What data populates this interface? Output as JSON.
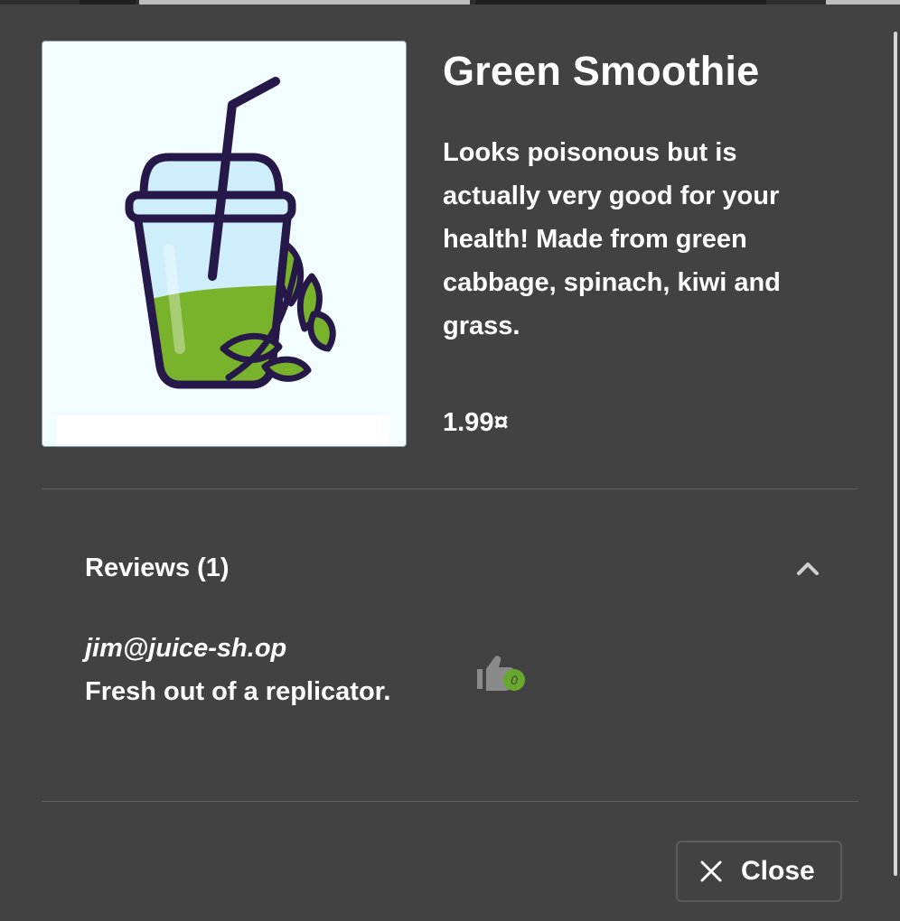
{
  "product": {
    "name": "Green Smoothie",
    "description": "Looks poisonous but is actually very good for your health! Made from green cabbage, spinach, kiwi and grass.",
    "price": "1.99¤",
    "image_icon": "smoothie-cup-with-leaves-illustration"
  },
  "reviews": {
    "header": "Reviews (1)",
    "toggle_icon": "chevron-up-icon",
    "items": [
      {
        "author": "jim@juice-sh.op",
        "message": "Fresh out of a replicator.",
        "likes": "0",
        "like_icon": "thumbs-up-icon"
      }
    ]
  },
  "actions": {
    "close_label": "Close",
    "close_icon": "close-icon"
  },
  "colors": {
    "dialog_background": "#424242",
    "image_background": "#f2fdff",
    "accent_green": "#69a82f",
    "text": "#ffffff"
  }
}
